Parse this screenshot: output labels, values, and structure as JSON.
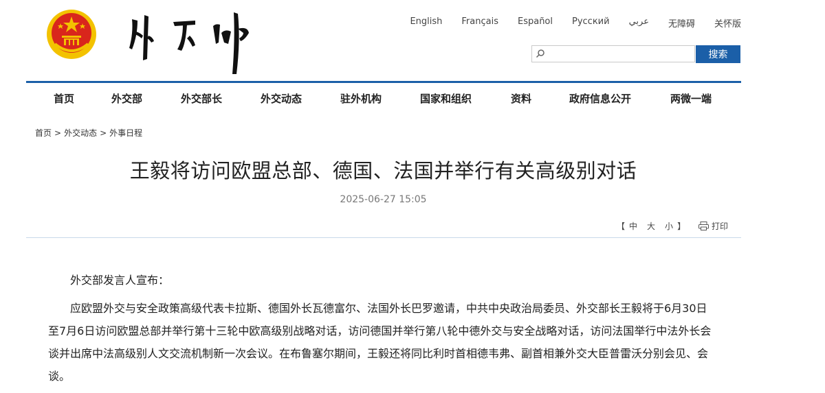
{
  "header": {
    "languages": [
      "English",
      "Français",
      "Español",
      "Русский",
      "عربي",
      "无障碍",
      "关怀版"
    ],
    "search": {
      "placeholder": "",
      "button_label": "搜索"
    },
    "colors": {
      "accent": "#1b5fa8",
      "emblem_red": "#d9261c",
      "emblem_gold": "#f3c200"
    }
  },
  "nav": {
    "items": [
      "首页",
      "外交部",
      "外交部长",
      "外交动态",
      "驻外机构",
      "国家和组织",
      "资料",
      "政府信息公开",
      "两微一端"
    ]
  },
  "breadcrumb": [
    "首页",
    "外交动态",
    "外事日程"
  ],
  "breadcrumb_separator": ">",
  "article": {
    "title": "王毅将访问欧盟总部、德国、法国并举行有关高级别对话",
    "date": "2025-06-27 15:05",
    "font_controls": {
      "open": "【",
      "large": "中",
      "medium": "大",
      "small": "小",
      "close": "】"
    },
    "print_label": "打印",
    "paragraphs": [
      "外交部发言人宣布：",
      "应欧盟外交与安全政策高级代表卡拉斯、德国外长瓦德富尔、法国外长巴罗邀请，中共中央政治局委员、外交部长王毅将于6月30日至7月6日访问欧盟总部并举行第十三轮中欧高级别战略对话，访问德国并举行第八轮中德外交与安全战略对话，访问法国举行中法外长会谈并出席中法高级别人文交流机制新一次会议。在布鲁塞尔期间，王毅还将同比利时首相德韦弗、副首相兼外交大臣普雷沃分别会见、会谈。"
    ]
  }
}
